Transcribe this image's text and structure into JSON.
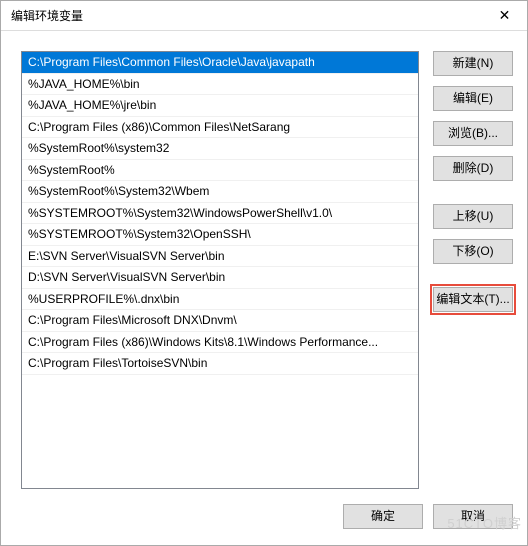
{
  "window": {
    "title": "编辑环境变量",
    "close": "✕"
  },
  "list": {
    "selected_index": 0,
    "items": [
      "C:\\Program Files\\Common Files\\Oracle\\Java\\javapath",
      "%JAVA_HOME%\\bin",
      "%JAVA_HOME%\\jre\\bin",
      "C:\\Program Files (x86)\\Common Files\\NetSarang",
      "%SystemRoot%\\system32",
      "%SystemRoot%",
      "%SystemRoot%\\System32\\Wbem",
      "%SYSTEMROOT%\\System32\\WindowsPowerShell\\v1.0\\",
      "%SYSTEMROOT%\\System32\\OpenSSH\\",
      "E:\\SVN Server\\VisualSVN Server\\bin",
      "D:\\SVN Server\\VisualSVN Server\\bin",
      "%USERPROFILE%\\.dnx\\bin",
      "C:\\Program Files\\Microsoft DNX\\Dnvm\\",
      "C:\\Program Files (x86)\\Windows Kits\\8.1\\Windows Performance...",
      "C:\\Program Files\\TortoiseSVN\\bin"
    ]
  },
  "buttons": {
    "new": "新建(N)",
    "edit": "编辑(E)",
    "browse": "浏览(B)...",
    "delete": "删除(D)",
    "move_up": "上移(U)",
    "move_down": "下移(O)",
    "edit_text": "编辑文本(T)...",
    "ok": "确定",
    "cancel": "取消"
  },
  "watermark": "51CTO博客"
}
